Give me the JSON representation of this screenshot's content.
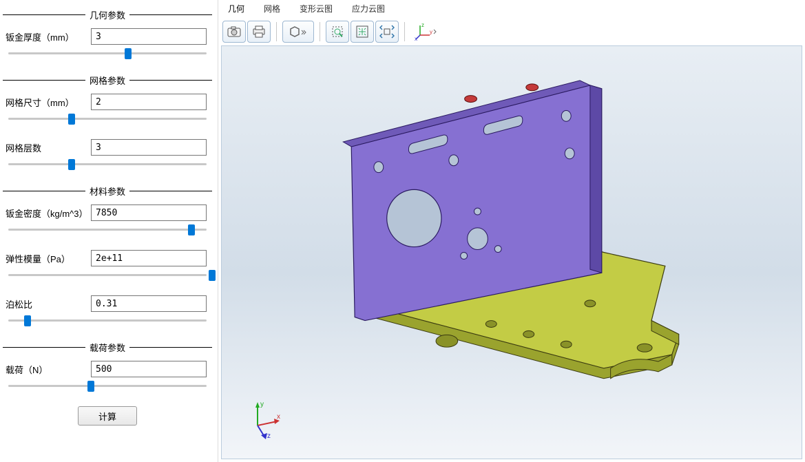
{
  "sections": {
    "geometry": {
      "title": "几何参数"
    },
    "mesh": {
      "title": "网格参数"
    },
    "material": {
      "title": "材料参数"
    },
    "load": {
      "title": "载荷参数"
    }
  },
  "params": {
    "thickness": {
      "label": "钣金厚度（mm）",
      "value": "3",
      "slider_pct": 60
    },
    "mesh_size": {
      "label": "网格尺寸（mm）",
      "value": "2",
      "slider_pct": 33
    },
    "mesh_layers": {
      "label": "网格层数",
      "value": "3",
      "slider_pct": 33
    },
    "density": {
      "label": "钣金密度（kg/m^3）",
      "value": "7850",
      "slider_pct": 90
    },
    "youngs": {
      "label": "弹性模量（Pa）",
      "value": "2e+11",
      "slider_pct": 100
    },
    "poisson": {
      "label": "泊松比",
      "value": "0.31",
      "slider_pct": 12
    },
    "load": {
      "label": "载荷（N）",
      "value": "500",
      "slider_pct": 42
    }
  },
  "buttons": {
    "calculate": "计算"
  },
  "tabs": {
    "geometry": "几何",
    "mesh": "网格",
    "deform": "变形云图",
    "stress": "应力云图",
    "active": "geometry"
  },
  "colors": {
    "part_vertical": "#7a5fc8",
    "part_base": "#b8c03a",
    "pins": "#c43a3a",
    "slider_thumb": "#0078d7"
  }
}
